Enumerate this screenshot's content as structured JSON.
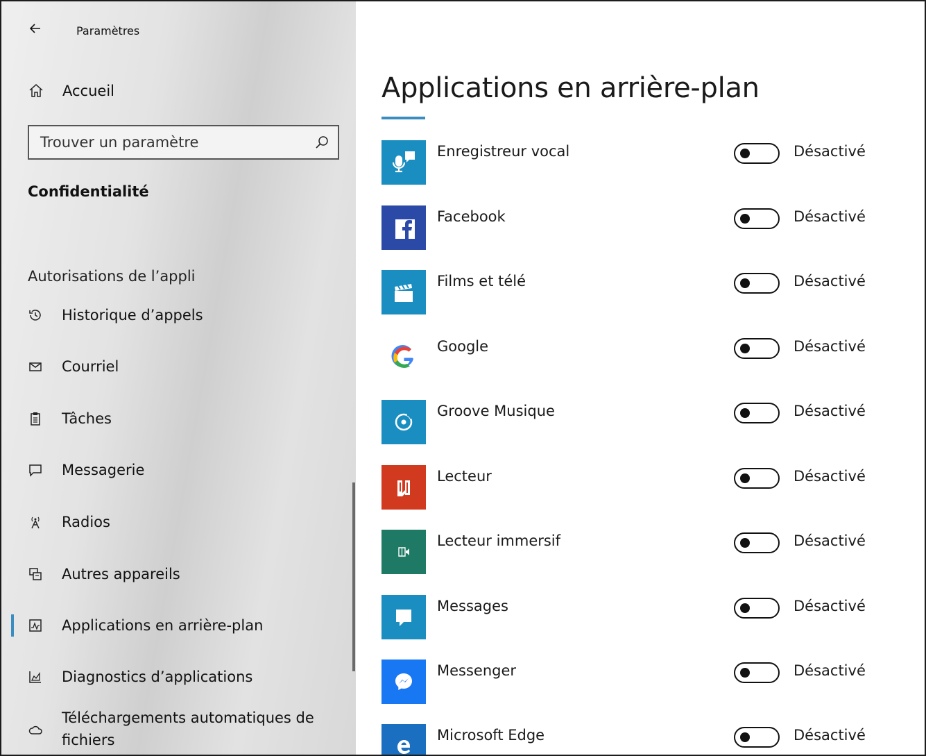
{
  "window": {
    "title": "Paramètres"
  },
  "sidebar": {
    "home_label": "Accueil",
    "search_placeholder": "Trouver un paramètre",
    "section_title": "Confidentialité",
    "group_title": "Autorisations de l’appli",
    "items": [
      {
        "label": "Historique d’appels",
        "icon": "history-icon",
        "active": false
      },
      {
        "label": "Courriel",
        "icon": "mail-icon",
        "active": false
      },
      {
        "label": "Tâches",
        "icon": "tasks-icon",
        "active": false
      },
      {
        "label": "Messagerie",
        "icon": "chat-icon",
        "active": false
      },
      {
        "label": "Radios",
        "icon": "radio-icon",
        "active": false
      },
      {
        "label": "Autres appareils",
        "icon": "devices-icon",
        "active": false
      },
      {
        "label": "Applications en arrière-plan",
        "icon": "background-apps-icon",
        "active": true
      },
      {
        "label": "Diagnostics d’applications",
        "icon": "diagnostics-icon",
        "active": false
      },
      {
        "label": "Téléchargements automatiques de fichiers",
        "label_line1": "Téléchargements automatiques de",
        "label_line2": "fichiers",
        "icon": "cloud-icon",
        "active": false
      }
    ]
  },
  "main": {
    "title": "Applications en arrière-plan",
    "apps": [
      {
        "name": "Enregistreur vocal",
        "state": "Désactivé",
        "icon": "voice-recorder-icon",
        "color": "#1a8ec1"
      },
      {
        "name": "Facebook",
        "state": "Désactivé",
        "icon": "facebook-icon",
        "color": "#3b5998"
      },
      {
        "name": "Films et télé",
        "state": "Désactivé",
        "icon": "movies-tv-icon",
        "color": "#1a8ec1"
      },
      {
        "name": "Google",
        "state": "Désactivé",
        "icon": "google-icon",
        "color": "#ffffff"
      },
      {
        "name": "Groove Musique",
        "state": "Désactivé",
        "icon": "groove-music-icon",
        "color": "#1a8ec1"
      },
      {
        "name": "Lecteur",
        "state": "Désactivé",
        "icon": "reader-icon",
        "color": "#d23a1f"
      },
      {
        "name": "Lecteur immersif",
        "state": "Désactivé",
        "icon": "immersive-reader-icon",
        "color": "#1e7a65"
      },
      {
        "name": "Messages",
        "state": "Désactivé",
        "icon": "messages-icon",
        "color": "#1a8ec1"
      },
      {
        "name": "Messenger",
        "state": "Désactivé",
        "icon": "messenger-icon",
        "color": "#1877f2"
      },
      {
        "name": "Microsoft Edge",
        "state": "Désactivé",
        "icon": "edge-icon",
        "color": "#1a6fc1"
      }
    ]
  },
  "colors": {
    "accent": "#3c8dbf"
  }
}
